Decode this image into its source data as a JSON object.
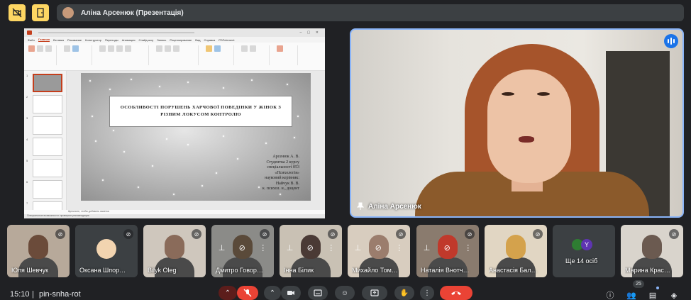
{
  "header": {
    "presenter_title": "Аліна Арсенюк (Презентація)"
  },
  "presentation": {
    "app": "PowerPoint",
    "tabs": [
      "Файл",
      "Главная",
      "Вставка",
      "Рисование",
      "Конструктор",
      "Переходы",
      "Анимация",
      "Слайд-шоу",
      "Запись",
      "Рецензирование",
      "Вид",
      "Справка",
      "PDFelement"
    ],
    "active_tab": "Главная",
    "slide_title": "ОСОБЛИВОСТІ ПОРУШЕНЬ ХАРЧОВОЇ ПОВЕДІНКИ У ЖІНОК З РІЗНИМ ЛОКУСОМ КОНТРОЛЮ",
    "slide_meta": [
      "Арсенюк А. В.",
      "Студентка 2 курсу",
      "спеціальності 053",
      "«Психологія»",
      "науковий керівник:",
      "Найчук В. В.",
      "к. психол. н., доцент"
    ],
    "notes_placeholder": "Щелкните, чтобы добавить заметки",
    "status": "Специальные возможности: проверьте рекомендации",
    "thumbnail_numbers": [
      "1",
      "2",
      "3",
      "4",
      "5",
      "6",
      "7"
    ]
  },
  "main_speaker": {
    "name": "Аліна Арсенюк"
  },
  "participants": [
    {
      "name": "Юля Шевчук",
      "muted": true,
      "avatar_color": "#6b4b3a"
    },
    {
      "name": "Оксана Шпор…",
      "muted": true,
      "avatar_color": "#f2d4b0"
    },
    {
      "name": "Bilyk Oleg",
      "muted": true,
      "avatar_color": "#8a6b5a"
    },
    {
      "name": "Дмитро Говор…",
      "muted": true,
      "avatar_color": "#5a4a3a"
    },
    {
      "name": "Інна Білик",
      "muted": true,
      "avatar_color": "#4a3a35"
    },
    {
      "name": "Михайло Том…",
      "muted": true,
      "avatar_color": "#9b7d6d"
    },
    {
      "name": "Наталія Внотч…",
      "muted": true,
      "avatar_color": "#c0392b"
    },
    {
      "name": "Анастасія Бал…",
      "muted": true,
      "avatar_color": "#d4a24c"
    },
    {
      "name": "Ще 14 осіб",
      "muted": false,
      "avatar_color": "#3c4043"
    },
    {
      "name": "Марина Крас…",
      "muted": true,
      "avatar_color": "#6b5a50"
    }
  ],
  "more_avatar_letter": "Y",
  "bottom": {
    "time": "15:10",
    "meeting_code": "pin-snha-rot",
    "participant_count": "25"
  },
  "icons": {
    "hand": "hand-icon",
    "mic_off": "mic-off-icon",
    "camera": "camera-icon",
    "captions": "captions-icon",
    "emoji": "emoji-icon",
    "present": "present-icon",
    "more": "more-vert-icon",
    "end_call": "call-end-icon",
    "info": "info-icon",
    "people": "people-icon",
    "chat": "chat-icon",
    "activities": "activities-icon"
  },
  "colors": {
    "accent": "#8ab4f8",
    "end_call": "#ea4335",
    "warning": "#fdd663"
  }
}
